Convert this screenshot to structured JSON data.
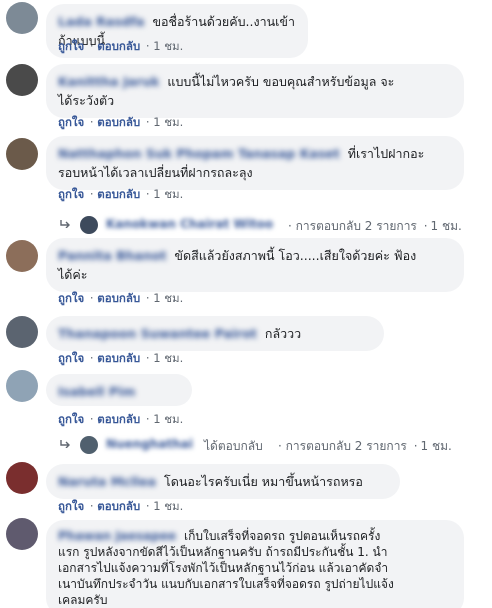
{
  "comments": [
    {
      "name": "Lada Rasdfa",
      "text": "ขอชื่อร้านด้วยคับ..งานเข้าถ้าแบบนี้",
      "like": "ถูกใจ",
      "reply": "ตอบกลับ",
      "time": "1 ชม."
    },
    {
      "name": "Kanittha Jaruk",
      "text": "แบบนี้ไม่ไหวครับ ขอบคุณสำหรับข้อมูล จะ\nได้ระวังตัว",
      "like": "ถูกใจ",
      "reply": "ตอบกลับ",
      "time": "1 ชม."
    },
    {
      "name": "Natthaphon Suk Phopam Tanasap Kaset",
      "text": "ที่เราไปฝากอะ\nรอบหน้าได้เวลาเปลี่ยนที่ฝากรถละลุง",
      "like": "ถูกใจ",
      "reply": "ตอบกลับ",
      "time": "1 ชม.",
      "replies_summary": {
        "name": "Kanokwan Chairat Witoo",
        "count": "การตอบกลับ 2 รายการ",
        "time": "1 ชม."
      }
    },
    {
      "name": "Pannita Bhanot",
      "text": "ขัดสีแล้วยังสภาพนี้ โอว.....เสียใจด้วยค่ะ ฟ้อง\nได้ค่ะ",
      "like": "ถูกใจ",
      "reply": "ตอบกลับ",
      "time": "1 ชม."
    },
    {
      "name": "Thanapoon Suwantee Pairot",
      "text": "กลัววว",
      "like": "ถูกใจ",
      "reply": "ตอบกลับ",
      "time": "1 ชม."
    },
    {
      "name": "Isabell Pim",
      "text": "",
      "like": "ถูกใจ",
      "reply": "ตอบกลับ",
      "time": "1 ชม.",
      "replies_summary": {
        "name": "Nuenghathai",
        "action": "ได้ตอบกลับ",
        "count": "การตอบกลับ 2 รายการ",
        "time": "1 ชม."
      }
    },
    {
      "name": "Naruta Mcllea",
      "text": "โดนอะไรครับเนี่ย หมาขึ้นหน้ารถหรอ",
      "like": "ถูกใจ",
      "reply": "ตอบกลับ",
      "time": "1 ชม."
    },
    {
      "name": "Phawan Jaesapee",
      "text": "เก็บใบเสร็จที่จอดรถ รูปตอนเห็นรถครั้ง\nแรก รูปหลังจากขัดสีไว้เป็นหลักฐานครับ ถ้ารถมีประกันชั้น 1. นำ\nเอกสารไปแจ้งความที่โรงพักไว้เป็นหลักฐานไว้ก่อน แล้วเอาคัดจำ\nเนาบันทึกประจำวัน แนบกับเอกสารใบเสร็จที่จอดรถ รูปถ่ายไปแจ้ง\nเคลมครับ"
    }
  ],
  "colors": {
    "link": "#385898",
    "meta": "#606770",
    "bubble": "#f2f3f5"
  }
}
